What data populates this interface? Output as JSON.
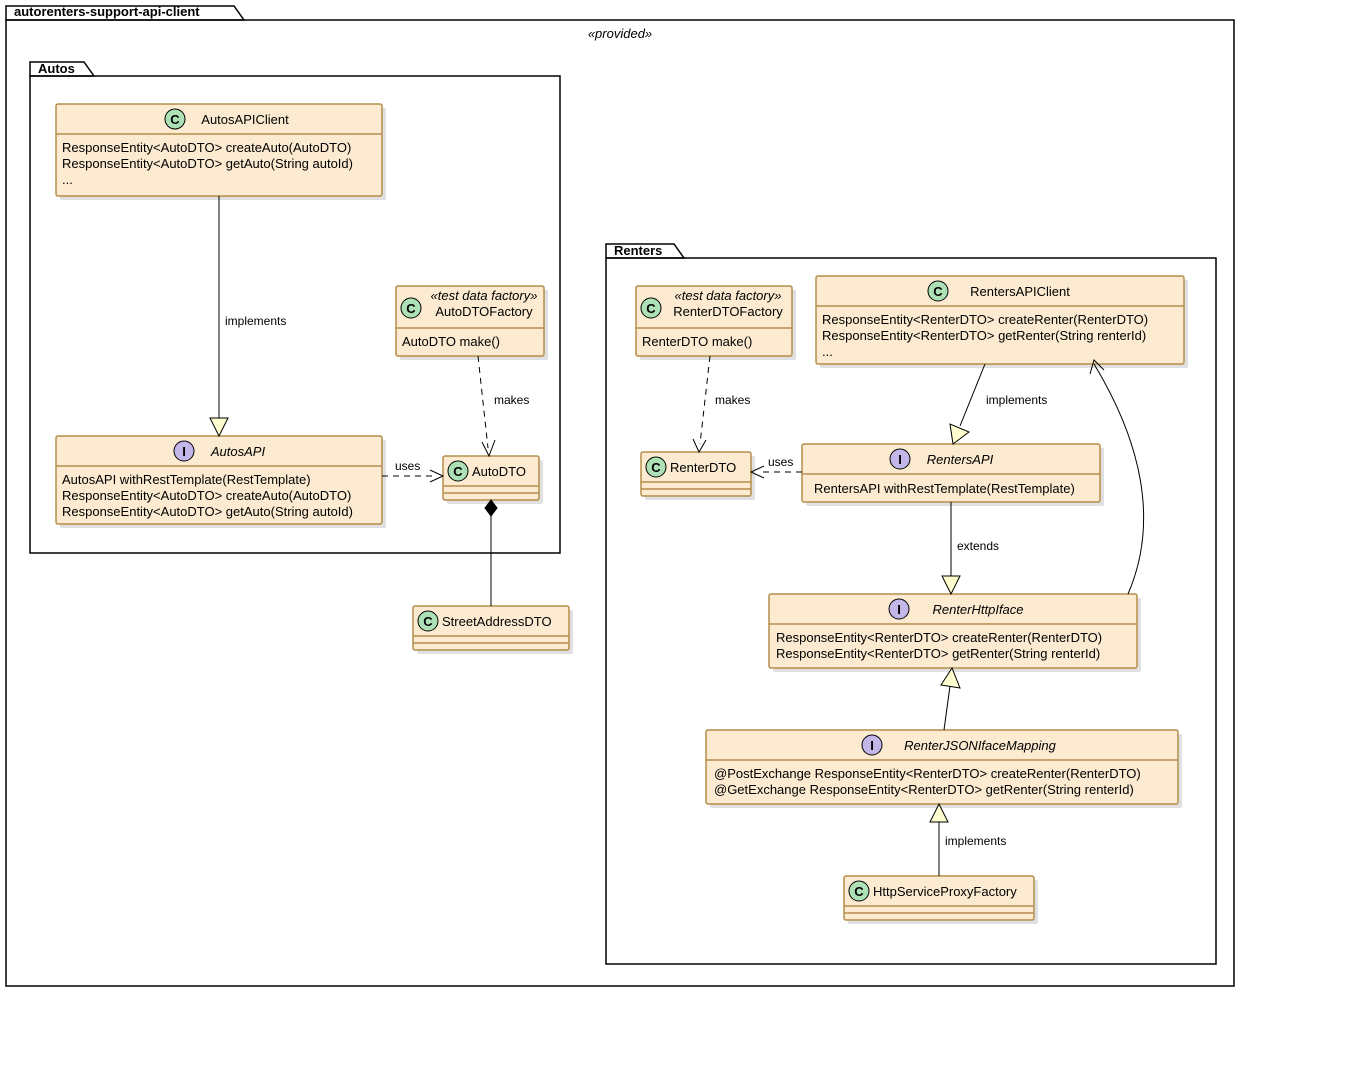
{
  "outer": {
    "title": "autorenters-support-api-client",
    "stereotype": "«provided»"
  },
  "pkgAutos": {
    "title": "Autos"
  },
  "pkgRenters": {
    "title": "Renters"
  },
  "autosApiClient": {
    "name": "AutosAPIClient",
    "l1": "ResponseEntity<AutoDTO> createAuto(AutoDTO)",
    "l2": "ResponseEntity<AutoDTO> getAuto(String autoId)",
    "l3": "..."
  },
  "autoDtoFactory": {
    "stereo": "«test data factory»",
    "name": "AutoDTOFactory",
    "l1": "AutoDTO make()"
  },
  "autosApi": {
    "name": "AutosAPI",
    "l1": "AutosAPI withRestTemplate(RestTemplate)",
    "l2": "ResponseEntity<AutoDTO> createAuto(AutoDTO)",
    "l3": "ResponseEntity<AutoDTO> getAuto(String autoId)"
  },
  "autoDto": {
    "name": "AutoDTO"
  },
  "streetAddressDto": {
    "name": "StreetAddressDTO"
  },
  "renterDtoFactory": {
    "stereo": "«test data factory»",
    "name": "RenterDTOFactory",
    "l1": "RenterDTO make()"
  },
  "rentersApiClient": {
    "name": "RentersAPIClient",
    "l1": "ResponseEntity<RenterDTO> createRenter(RenterDTO)",
    "l2": "ResponseEntity<RenterDTO> getRenter(String renterId)",
    "l3": "..."
  },
  "renterDto": {
    "name": "RenterDTO"
  },
  "rentersApi": {
    "name": "RentersAPI",
    "l1": "RentersAPI withRestTemplate(RestTemplate)"
  },
  "renterHttpIface": {
    "name": "RenterHttpIface",
    "l1": "ResponseEntity<RenterDTO> createRenter(RenterDTO)",
    "l2": "ResponseEntity<RenterDTO> getRenter(String renterId)"
  },
  "renterJsonIface": {
    "name": "RenterJSONIfaceMapping",
    "l1": "@PostExchange ResponseEntity<RenterDTO> createRenter(RenterDTO)",
    "l2": "@GetExchange ResponseEntity<RenterDTO> getRenter(String renterId)"
  },
  "httpServiceProxyFactory": {
    "name": "HttpServiceProxyFactory"
  },
  "rel": {
    "implements": "implements",
    "makes": "makes",
    "uses": "uses",
    "extends": "extends"
  }
}
